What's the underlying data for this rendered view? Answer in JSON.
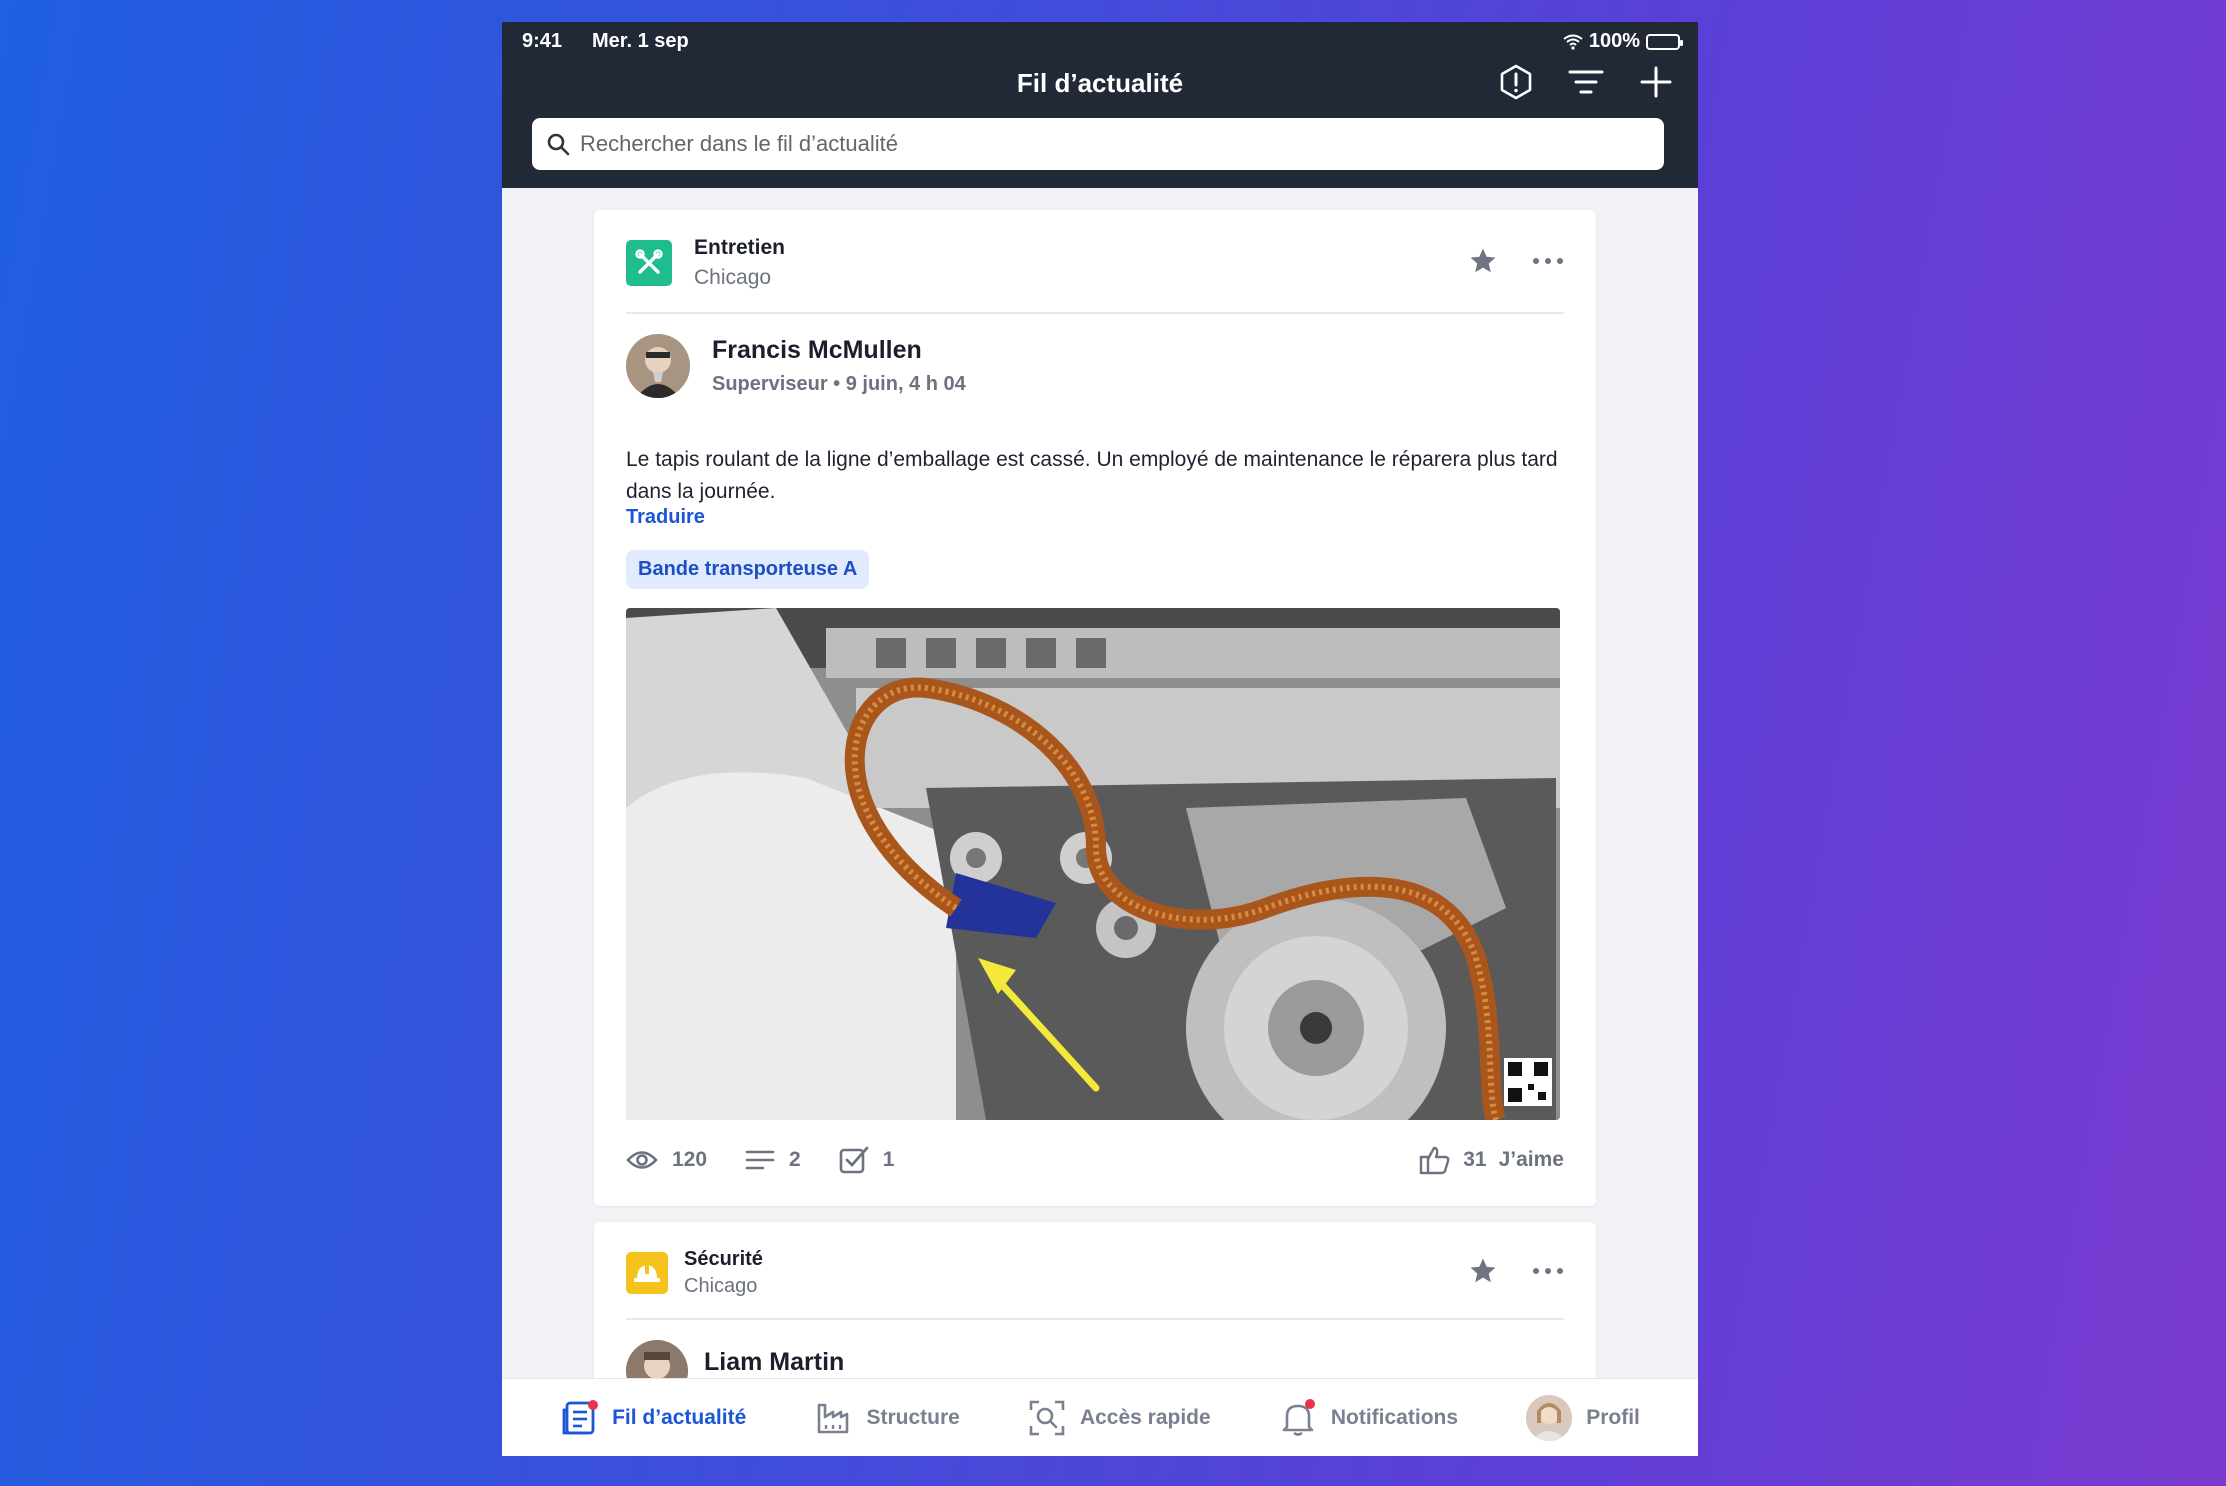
{
  "status_bar": {
    "time": "9:41",
    "date": "Mer. 1 sep",
    "battery": "100%"
  },
  "header": {
    "title": "Fil d’actualité"
  },
  "search": {
    "placeholder": "Rechercher dans le fil d’actualité"
  },
  "posts": [
    {
      "category": "Entretien",
      "location": "Chicago",
      "category_color": "#1ebc8f",
      "author": "Francis McMullen",
      "meta": "Superviseur • 9 juin, 4 h 04",
      "body": "Le tapis roulant de la ligne d’emballage est cassé. Un employé de maintenance le réparera plus tard dans la journée.",
      "translate": "Traduire",
      "tag": "Bande transporteuse A",
      "stats": {
        "views": "120",
        "comments": "2",
        "tasks": "1",
        "likes": "31",
        "likes_label": "J’aime"
      }
    },
    {
      "category": "Sécurité",
      "location": "Chicago",
      "category_color": "#f6c21c",
      "author": "Liam Martin"
    }
  ],
  "tabbar": {
    "feed": "Fil d’actualité",
    "structure": "Structure",
    "quick_access": "Accès rapide",
    "notifications": "Notifications",
    "profile": "Profil"
  },
  "colors": {
    "accent": "#1c56d6",
    "topbar": "#212836",
    "notification_dot": "#e8334a"
  }
}
